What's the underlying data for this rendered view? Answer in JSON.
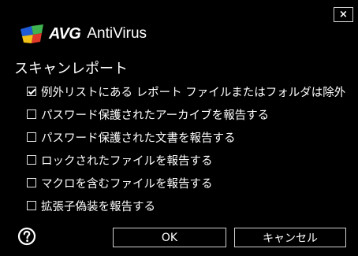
{
  "window": {
    "close_glyph": "×",
    "brand": "AVG",
    "product": "AntiVirus"
  },
  "section_title": "スキャンレポート",
  "options": [
    {
      "label": "例外リストにある レポート ファイルまたはフォルダは除外",
      "checked": true
    },
    {
      "label": "パスワード保護されたアーカイブを報告する",
      "checked": false
    },
    {
      "label": "パスワード保護された文書を報告する",
      "checked": false
    },
    {
      "label": "ロックされたファイルを報告する",
      "checked": false
    },
    {
      "label": "マクロを含むファイルを報告する",
      "checked": false
    },
    {
      "label": "拡張子偽装を報告する",
      "checked": false
    }
  ],
  "buttons": {
    "ok": "OK",
    "cancel": "キャンセル"
  },
  "icons": {
    "help": "help-icon",
    "logo": "avg-logo-icon",
    "close": "close-icon",
    "checkbox": "checkbox-icon"
  },
  "colors": {
    "background": "#000000",
    "text": "#ffffff",
    "border": "#d0d0d0",
    "logo_blue": "#1f5bd6",
    "logo_green": "#3fb34f",
    "logo_yellow": "#f2c118",
    "logo_red": "#e2382a"
  }
}
